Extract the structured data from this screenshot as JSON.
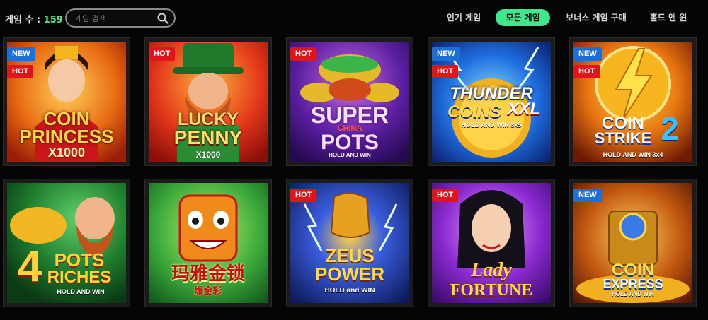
{
  "header": {
    "count_label": "게임 수 : ",
    "count_value": "159",
    "search_placeholder": "게임 검색"
  },
  "tabs": [
    {
      "label": "인기 게임",
      "active": false
    },
    {
      "label": "모든 게임",
      "active": true
    },
    {
      "label": "보너스 게임 구매",
      "active": false
    },
    {
      "label": "홀드 앤 윈",
      "active": false
    }
  ],
  "colors": {
    "accent": "#3ee88a",
    "new_badge": "#1c6fd6",
    "hot_badge": "#e0151b",
    "count_number": "#59e38a"
  },
  "badges": {
    "new": "NEW",
    "hot": "HOT"
  },
  "games": [
    {
      "title_lines": [
        "COIN",
        "PRINCESS",
        "X1000"
      ],
      "badges": [
        "NEW",
        "HOT"
      ],
      "theme": "princess"
    },
    {
      "title_lines": [
        "LUCKY",
        "PENNY",
        "X1000"
      ],
      "badges": [
        "HOT"
      ],
      "theme": "leprechaun"
    },
    {
      "title_lines": [
        "SUPER",
        "CHINA",
        "POTS",
        "HOLD AND WIN"
      ],
      "badges": [
        "HOT"
      ],
      "theme": "pots"
    },
    {
      "title_lines": [
        "THUNDER",
        "COINS",
        "XXL",
        "HOLD AND WIN 3x5"
      ],
      "badges": [
        "NEW",
        "HOT"
      ],
      "theme": "thunder"
    },
    {
      "title_lines": [
        "COIN",
        "STRIKE",
        "2",
        "HOLD AND WIN 3x4"
      ],
      "badges": [
        "NEW",
        "HOT"
      ],
      "theme": "strike"
    },
    {
      "title_lines": [
        "4",
        "POTS",
        "RICHES",
        "HOLD AND WIN"
      ],
      "badges": [],
      "theme": "riches"
    },
    {
      "title_lines": [
        "玛雅金锁",
        "爆金彩"
      ],
      "badges": [],
      "theme": "maya"
    },
    {
      "title_lines": [
        "ZEUS",
        "POWER",
        "HOLD and WIN"
      ],
      "badges": [
        "HOT"
      ],
      "theme": "zeus"
    },
    {
      "title_lines": [
        "Lady",
        "FORTUNE"
      ],
      "badges": [
        "HOT"
      ],
      "theme": "lady"
    },
    {
      "title_lines": [
        "COIN",
        "EXPRESS",
        "HOLD AND WIN"
      ],
      "badges": [
        "NEW"
      ],
      "theme": "express"
    }
  ]
}
